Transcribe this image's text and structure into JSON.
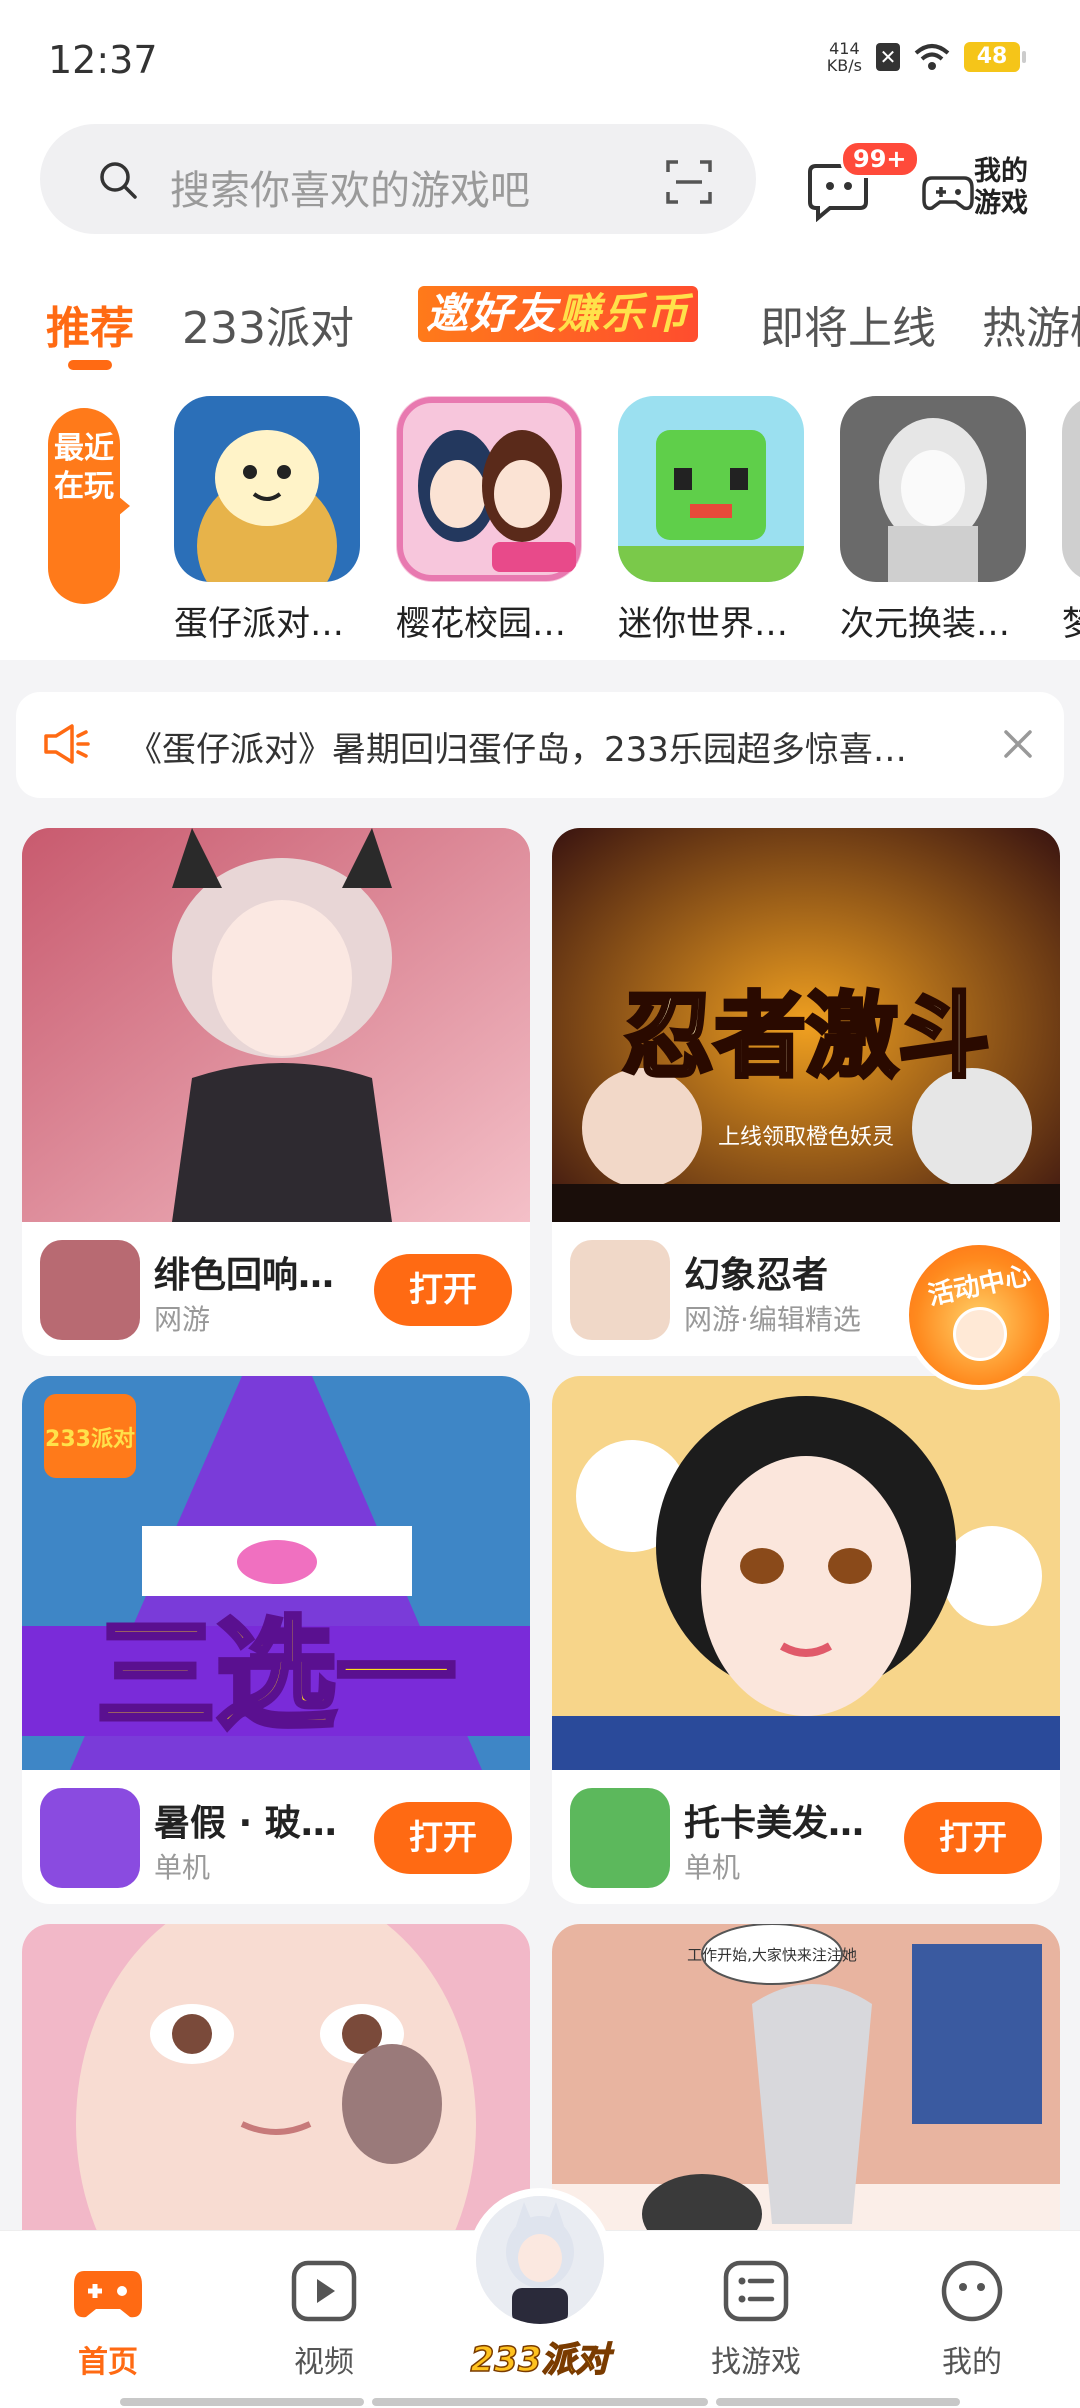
{
  "status_bar": {
    "time": "12:37",
    "net_speed_value": "414",
    "net_speed_unit": "KB/s",
    "sim_label": "✕",
    "battery": "48"
  },
  "search": {
    "placeholder": "搜索你喜欢的游戏吧"
  },
  "header": {
    "message_badge": "99+",
    "my_games_label": "我的游戏"
  },
  "tabs": [
    {
      "label": "推荐",
      "active": true
    },
    {
      "label": "233派对",
      "active": false
    },
    {
      "label": "即将上线",
      "active": false
    },
    {
      "label": "热游榜",
      "active": false
    }
  ],
  "promo_tab": {
    "part1": "邀好友",
    "part2": "赚乐币"
  },
  "recent": {
    "tag": "最近在玩",
    "games": [
      {
        "name": "蛋仔派对…",
        "icon": "egg-party-icon",
        "color": "#4aa3e8"
      },
      {
        "name": "樱花校园…",
        "icon": "sakura-school-icon",
        "color": "#f4a6c8"
      },
      {
        "name": "迷你世界…",
        "icon": "mini-world-icon",
        "color": "#6fcf5a"
      },
      {
        "name": "次元换装…",
        "icon": "dress-up-icon",
        "color": "#9a9a9a"
      },
      {
        "name": "梦",
        "icon": "game-icon",
        "color": "#cfcfcf"
      }
    ]
  },
  "notice": {
    "text": "《蛋仔派对》暑期回归蛋仔岛，233乐园超多惊喜…"
  },
  "cards": [
    {
      "title": "绯色回响…",
      "subtitle": "网游",
      "button": "打开",
      "image_color": "#e8a0aa",
      "thumb_color": "#b86a72"
    },
    {
      "title": "幻象忍者",
      "subtitle": "网游·编辑精选",
      "button": "",
      "image_color": "#5a2a1a",
      "thumb_color": "#f0d8c8",
      "overlay_title": "忍者激斗",
      "overlay_sub": "上线领取橙色妖灵"
    },
    {
      "title": "暑假 · 玻…",
      "subtitle": "单机",
      "button": "打开",
      "image_color": "#7b3bd9",
      "thumb_color": "#8a4be0",
      "overlay_title": "三选一",
      "overlay_badge": "233派对"
    },
    {
      "title": "托卡美发…",
      "subtitle": "单机",
      "button": "打开",
      "image_color": "#f7d58a",
      "thumb_color": "#5cb85c"
    },
    {
      "title": "",
      "subtitle": "",
      "button": "",
      "image_color": "#f2c8c8"
    },
    {
      "title": "",
      "subtitle": "",
      "button": "",
      "image_color": "#e8b4a0",
      "overlay_bubble": "工作开始,大家快来注注她"
    }
  ],
  "activity_badge": "活动中心",
  "bottom_nav": [
    {
      "label": "首页",
      "icon": "gamepad-icon",
      "active": true
    },
    {
      "label": "视频",
      "icon": "video-play-icon",
      "active": false
    },
    {
      "label": "找游戏",
      "icon": "list-icon",
      "active": false
    },
    {
      "label": "我的",
      "icon": "profile-face-icon",
      "active": false
    }
  ],
  "center_tab": {
    "label": "233派对"
  },
  "colors": {
    "accent": "#ff6a13",
    "badge_red": "#ff4a3a"
  }
}
